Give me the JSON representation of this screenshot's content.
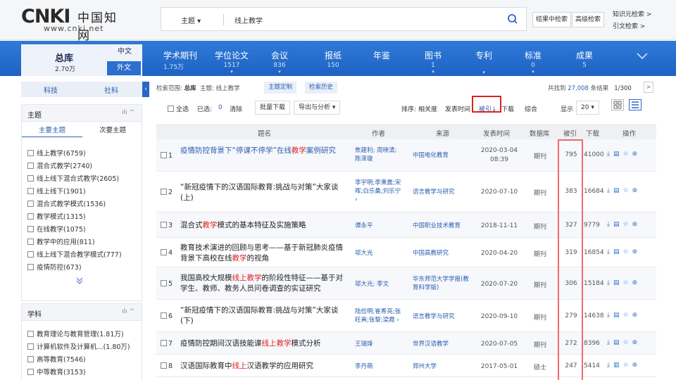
{
  "header": {
    "logo_brand": "CNKI",
    "logo_cn": "中国知网",
    "logo_www": "www.cnki.net",
    "search_field": "主题 ▾",
    "search_query": "线上教学",
    "btn_search_in_results": "结果中检索",
    "btn_advanced": "高级检索",
    "link_knowledge": "知识元检索 >",
    "link_citation": "引文检索 >"
  },
  "nav": {
    "total_label": "总库",
    "total_count": "2.70万",
    "lang_zh": "中文",
    "lang_foreign": "外文",
    "items": [
      {
        "label": "学术期刊",
        "count": "1.75万",
        "caret": ""
      },
      {
        "label": "学位论文",
        "count": "1517",
        "caret": "▾"
      },
      {
        "label": "会议",
        "count": "836",
        "caret": "▾"
      },
      {
        "label": "报纸",
        "count": "150",
        "caret": ""
      },
      {
        "label": "年鉴",
        "count": "",
        "caret": ""
      },
      {
        "label": "图书",
        "count": "1",
        "caret": "▾"
      },
      {
        "label": "专利",
        "count": "",
        "caret": "▾"
      },
      {
        "label": "标准",
        "count": "0",
        "caret": "▾"
      },
      {
        "label": "成果",
        "count": "5",
        "caret": ""
      }
    ]
  },
  "sidebar": {
    "tab_tech": "科技",
    "tab_social": "社科",
    "topic_panel": {
      "title": "主题",
      "tab_main": "主要主题",
      "tab_secondary": "次要主题",
      "items": [
        "线上教学(6759)",
        "混合式教学(2740)",
        "线上线下混合式教学(2605)",
        "线上线下(1901)",
        "混合式教学模式(1536)",
        "教学模式(1315)",
        "在线教学(1075)",
        "教学中的应用(811)",
        "线上线下混合教学模式(777)",
        "疫情防控(673)"
      ]
    },
    "subject_panel": {
      "title": "学科",
      "items": [
        "教育理论与教育管理(1.81万)",
        "计算机软件及计算机...(1.80万)",
        "高等教育(7546)",
        "中等教育(3153)"
      ]
    }
  },
  "results_bar": {
    "scope_label": "检索范围:",
    "scope_total": "总库",
    "scope_topic": "主题: 线上教学",
    "pill_custom": "主题定制",
    "pill_history": "检索历史",
    "found_prefix": "共找到",
    "found_count": "27,008",
    "found_suffix": "条结果",
    "page": "1/300",
    "next": ">"
  },
  "toolbar": {
    "select_all": "全选",
    "selected_label": "已选:",
    "selected_count": "0",
    "clear": "清除",
    "batch_download": "批量下载",
    "export": "导出与分析 ▾",
    "sort_label": "排序:",
    "sort_relevance": "相关度",
    "sort_date": "发表时间",
    "sort_cited": "被引↓",
    "sort_download": "下载",
    "sort_combined": "综合",
    "display_label": "显示",
    "display_count": "20 ▾"
  },
  "table": {
    "headers": [
      "题名",
      "作者",
      "来源",
      "发表时间",
      "数据库",
      "被引",
      "下载",
      "操作"
    ],
    "rows": [
      {
        "no": "1",
        "title_pre": "疫情防控背景下“停课不停学”在线",
        "title_hl": "教学",
        "title_post": "案例研究",
        "title_blue": true,
        "author": "焦建利; 周晓清; 陈泽璇",
        "source": "中国电化教育",
        "date": "2020-03-04 08:39",
        "db": "期刊",
        "cited": "795",
        "download": "41000"
      },
      {
        "no": "2",
        "title_pre": "“新冠疫情下的汉语国际教育:挑战与对策”大家谈(上)",
        "title_hl": "",
        "title_post": "",
        "title_blue": false,
        "author": "李宇明;李秉震;宋晖;白乐桑;刘乐宁 ›",
        "source": "语言教学与研究",
        "date": "2020-07-10",
        "db": "期刊",
        "cited": "383",
        "download": "16684"
      },
      {
        "no": "3",
        "title_pre": "混合式",
        "title_hl": "教学",
        "title_post": "模式的基本特征及实施策略",
        "title_blue": false,
        "author": "谭永平",
        "source": "中国职业技术教育",
        "date": "2018-11-11",
        "db": "期刊",
        "cited": "327",
        "download": "9779"
      },
      {
        "no": "4",
        "title_pre": "教育技术演进的回顾与思考——基于新冠肺炎疫情背景下高校在线",
        "title_hl": "教学",
        "title_post": "的视角",
        "title_blue": false,
        "author": "邬大光",
        "source": "中国高教研究",
        "date": "2020-04-20",
        "db": "期刊",
        "cited": "319",
        "download": "16854"
      },
      {
        "no": "5",
        "title_pre": "我国高校大规模",
        "title_hl": "线上教学",
        "title_post": "的阶段性特征——基于对学生、教师、教务人员问卷调查的实证研究",
        "title_blue": false,
        "author": "邬大光; 李文",
        "source": "华东师范大学学报(教育科学版)",
        "date": "2020-07-20",
        "db": "期刊",
        "cited": "306",
        "download": "15184"
      },
      {
        "no": "6",
        "title_pre": "“新冠疫情下的汉语国际教育:挑战与对策”大家谈(下)",
        "title_hl": "",
        "title_post": "",
        "title_blue": false,
        "author": "陆俭明;崔希亮;张旺熹;张黎;梁霞 ›",
        "source": "语言教学与研究",
        "date": "2020-09-10",
        "db": "期刊",
        "cited": "279",
        "download": "14638"
      },
      {
        "no": "7",
        "title_pre": "疫情防控期间汉语技能课",
        "title_hl": "线上教学",
        "title_post": "模式分析",
        "title_blue": false,
        "author": "王瑞烽",
        "source": "世界汉语教学",
        "date": "2020-07-05",
        "db": "期刊",
        "cited": "272",
        "download": "8396"
      },
      {
        "no": "8",
        "title_pre": "汉语国际教育中",
        "title_hl": "线上",
        "title_post": "汉语教学的应用研究",
        "title_blue": false,
        "author": "李丹萌",
        "source": "郑州大学",
        "date": "2017-05-01",
        "db": "硕士",
        "cited": "247",
        "download": "5414"
      }
    ]
  },
  "icons": {
    "search": "search-icon",
    "download": "download-icon",
    "read": "read-icon",
    "favorite": "star-icon",
    "cite": "cite-icon"
  },
  "colors": {
    "brand_blue": "#1e62c3",
    "link_blue": "#2a5eb0",
    "highlight_red": "#e02020"
  }
}
